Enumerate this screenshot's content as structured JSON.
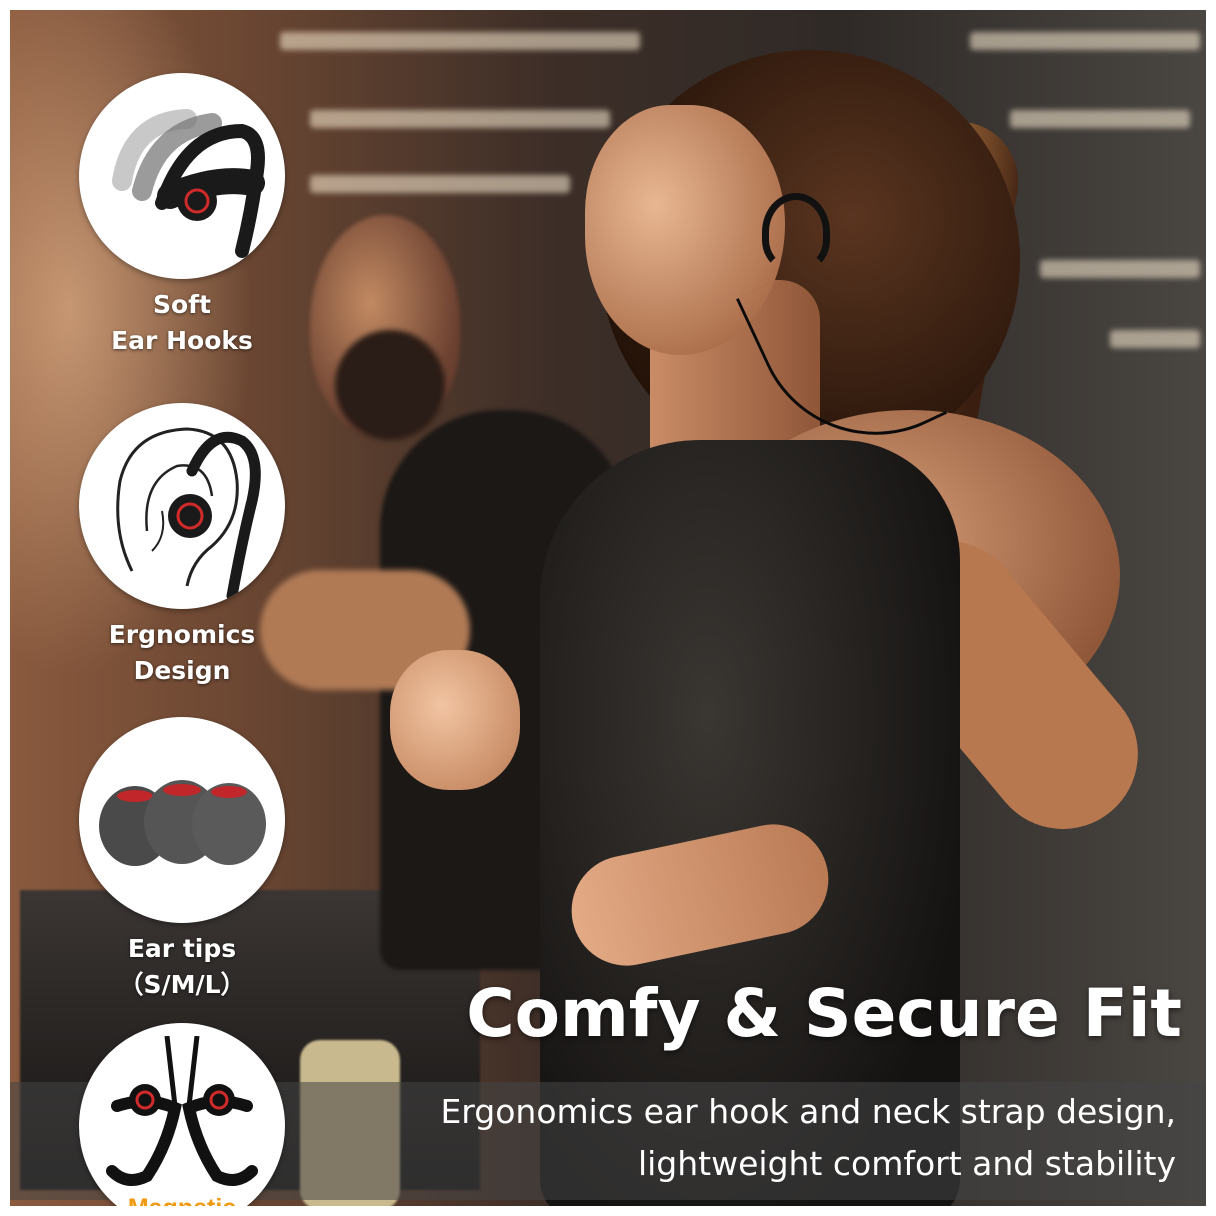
{
  "features": [
    {
      "icon": "ear-hook-flex-icon",
      "lines": [
        "Soft",
        "Ear Hooks"
      ]
    },
    {
      "icon": "ear-fit-icon",
      "lines": [
        "Ergnomics",
        "Design"
      ]
    },
    {
      "icon": "ear-tips-icon",
      "lines": [
        "Ear tips",
        "（S/M/L）"
      ]
    },
    {
      "icon": "magnetic-earbuds-icon",
      "lines": [
        "Magnetic"
      ]
    }
  ],
  "headline": "Comfy & Secure Fit",
  "subtitle_lines": [
    "Ergonomics ear hook and neck strap design,",
    "lightweight comfort and stability"
  ],
  "colors": {
    "label_text": "#ffffff",
    "magnetic_text": "#f09a12",
    "accent_red": "#d12a2a",
    "earbud_body": "#1a1a1a"
  }
}
